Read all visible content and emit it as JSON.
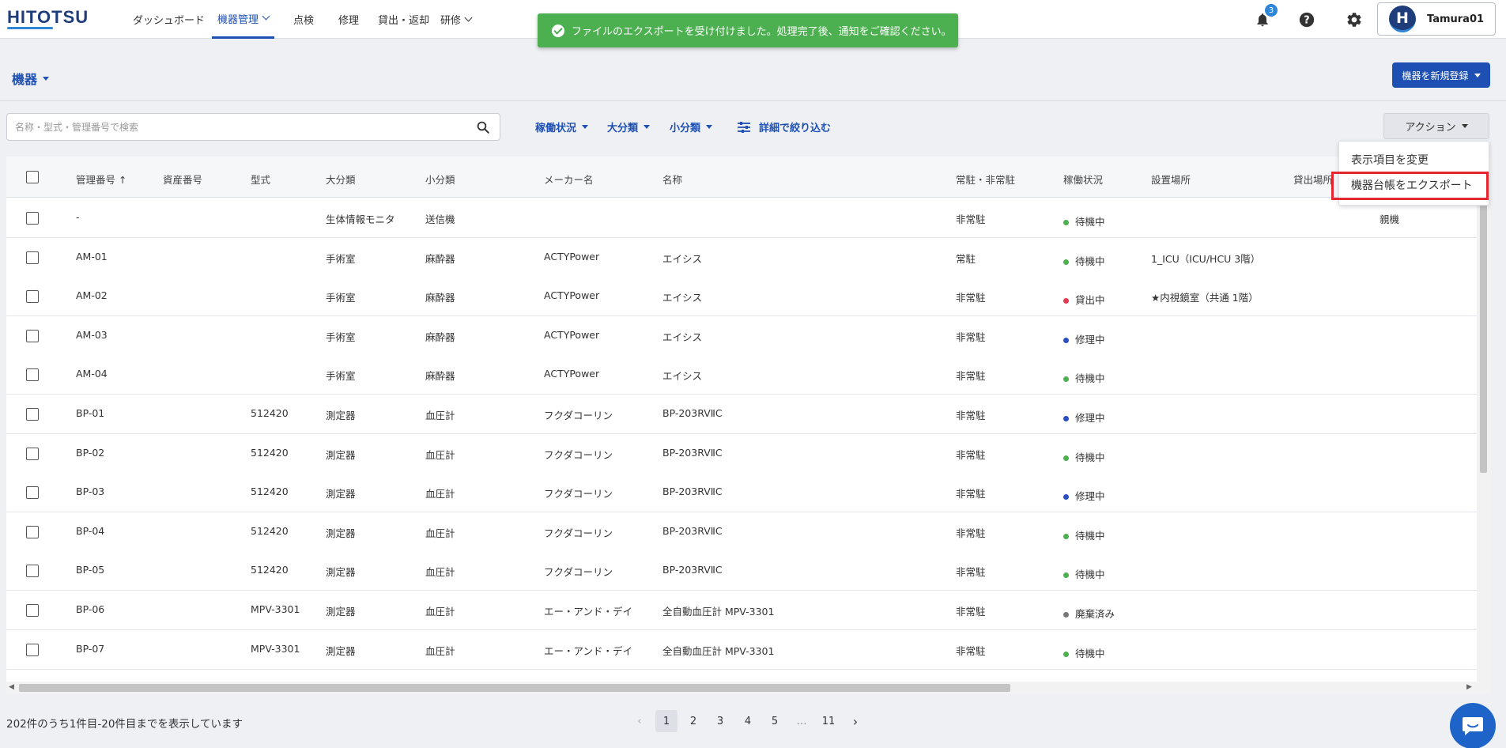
{
  "header": {
    "logo": "HITOTSU",
    "nav": [
      {
        "label": "ダッシュボード"
      },
      {
        "label": "機器管理"
      },
      {
        "label": "点検"
      },
      {
        "label": "修理"
      },
      {
        "label": "貸出・返却"
      },
      {
        "label": "研修"
      }
    ],
    "notification_count": "3",
    "user": {
      "initial": "H",
      "name": "Tamura01"
    }
  },
  "toast": {
    "message": "ファイルのエクスポートを受け付けました。処理完了後、通知をご確認ください。"
  },
  "page": {
    "title": "機器",
    "new_button": "機器を新規登録"
  },
  "search": {
    "placeholder": "名称・型式・管理番号で検索",
    "value": ""
  },
  "filters": {
    "status": "稼働状況",
    "major": "大分類",
    "minor": "小分類",
    "detail": "詳細で絞り込む"
  },
  "actions": {
    "button": "アクション",
    "menu": [
      "表示項目を変更",
      "機器台帳をエクスポート"
    ]
  },
  "table": {
    "columns": [
      "管理番号 ↑",
      "資産番号",
      "型式",
      "大分類",
      "小分類",
      "メーカー名",
      "名称",
      "常駐・非常駐",
      "稼働状況",
      "設置場所",
      "貸出場所"
    ],
    "rows": [
      {
        "id": "-",
        "asset": "",
        "model": "",
        "major": "生体情報モニタ",
        "minor": "送信機",
        "maker": "",
        "name": "",
        "resident": "非常駐",
        "status": "待機中",
        "status_color": "#4caf50",
        "location": "",
        "extra": "親機"
      },
      {
        "id": "AM-01",
        "asset": "",
        "model": "",
        "major": "手術室",
        "minor": "麻酔器",
        "maker": "ACTYPower",
        "name": "エイシス",
        "resident": "常駐",
        "status": "待機中",
        "status_color": "#4caf50",
        "location": "1_ICU（ICU/HCU 3階）",
        "extra": ""
      },
      {
        "id": "AM-02",
        "asset": "",
        "model": "",
        "major": "手術室",
        "minor": "麻酔器",
        "maker": "ACTYPower",
        "name": "エイシス",
        "resident": "非常駐",
        "status": "貸出中",
        "status_color": "#e53950",
        "location": "★内視鏡室（共通 1階）",
        "extra": ""
      },
      {
        "id": "AM-03",
        "asset": "",
        "model": "",
        "major": "手術室",
        "minor": "麻酔器",
        "maker": "ACTYPower",
        "name": "エイシス",
        "resident": "非常駐",
        "status": "修理中",
        "status_color": "#2a4fbf",
        "location": "",
        "extra": ""
      },
      {
        "id": "AM-04",
        "asset": "",
        "model": "",
        "major": "手術室",
        "minor": "麻酔器",
        "maker": "ACTYPower",
        "name": "エイシス",
        "resident": "非常駐",
        "status": "待機中",
        "status_color": "#4caf50",
        "location": "",
        "extra": ""
      },
      {
        "id": "BP-01",
        "asset": "",
        "model": "512420",
        "major": "測定器",
        "minor": "血圧計",
        "maker": "フクダコーリン",
        "name": "BP-203RVⅡC",
        "resident": "非常駐",
        "status": "修理中",
        "status_color": "#2a4fbf",
        "location": "",
        "extra": ""
      },
      {
        "id": "BP-02",
        "asset": "",
        "model": "512420",
        "major": "測定器",
        "minor": "血圧計",
        "maker": "フクダコーリン",
        "name": "BP-203RVⅡC",
        "resident": "非常駐",
        "status": "待機中",
        "status_color": "#4caf50",
        "location": "",
        "extra": ""
      },
      {
        "id": "BP-03",
        "asset": "",
        "model": "512420",
        "major": "測定器",
        "minor": "血圧計",
        "maker": "フクダコーリン",
        "name": "BP-203RVⅡC",
        "resident": "非常駐",
        "status": "修理中",
        "status_color": "#2a4fbf",
        "location": "",
        "extra": ""
      },
      {
        "id": "BP-04",
        "asset": "",
        "model": "512420",
        "major": "測定器",
        "minor": "血圧計",
        "maker": "フクダコーリン",
        "name": "BP-203RVⅡC",
        "resident": "非常駐",
        "status": "待機中",
        "status_color": "#4caf50",
        "location": "",
        "extra": ""
      },
      {
        "id": "BP-05",
        "asset": "",
        "model": "512420",
        "major": "測定器",
        "minor": "血圧計",
        "maker": "フクダコーリン",
        "name": "BP-203RVⅡC",
        "resident": "非常駐",
        "status": "待機中",
        "status_color": "#4caf50",
        "location": "",
        "extra": ""
      },
      {
        "id": "BP-06",
        "asset": "",
        "model": "MPV-3301",
        "major": "測定器",
        "minor": "血圧計",
        "maker": "エー・アンド・デイ",
        "name": "全自動血圧計 MPV-3301",
        "resident": "非常駐",
        "status": "廃棄済み",
        "status_color": "#777777",
        "location": "",
        "extra": ""
      },
      {
        "id": "BP-07",
        "asset": "",
        "model": "MPV-3301",
        "major": "測定器",
        "minor": "血圧計",
        "maker": "エー・アンド・デイ",
        "name": "全自動血圧計 MPV-3301",
        "resident": "非常駐",
        "status": "待機中",
        "status_color": "#4caf50",
        "location": "",
        "extra": ""
      }
    ]
  },
  "footer": {
    "summary": "202件のうち1件目-20件目までを表示しています",
    "pages": [
      "1",
      "2",
      "3",
      "4",
      "5",
      "…",
      "11"
    ],
    "current_page": "1"
  },
  "colors": {
    "primary": "#1e50b4",
    "success": "#4caf50",
    "highlight": "#e3262f"
  }
}
